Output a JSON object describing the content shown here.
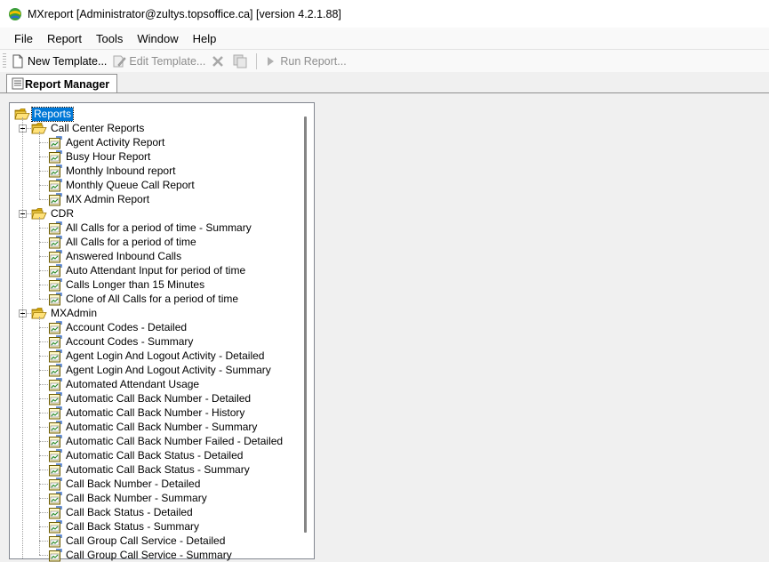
{
  "window": {
    "title": "MXreport [Administrator@zultys.topsoffice.ca] [version 4.2.1.88]"
  },
  "menu": [
    "File",
    "Report",
    "Tools",
    "Window",
    "Help"
  ],
  "toolbar": {
    "new_template": "New Template...",
    "edit_template": "Edit Template...",
    "run_report": "Run Report..."
  },
  "tab": {
    "label": "Report Manager"
  },
  "tree": {
    "root": "Reports",
    "groups": [
      {
        "label": "Call Center Reports",
        "items": [
          "Agent Activity Report",
          "Busy Hour Report",
          "Monthly Inbound report",
          "Monthly Queue Call Report",
          "MX Admin Report"
        ]
      },
      {
        "label": "CDR",
        "items": [
          "All Calls for a period of time -  Summary",
          "All Calls for a period of time",
          "Answered Inbound Calls",
          "Auto Attendant Input for period of time",
          "Calls Longer than 15 Minutes",
          "Clone of All Calls for a period of time"
        ]
      },
      {
        "label": "MXAdmin",
        "items": [
          "Account Codes - Detailed",
          "Account Codes - Summary",
          "Agent Login And Logout Activity - Detailed",
          "Agent Login And Logout Activity - Summary",
          "Automated Attendant Usage",
          "Automatic Call Back Number - Detailed",
          "Automatic Call Back Number - History",
          "Automatic Call Back Number - Summary",
          "Automatic Call Back Number Failed - Detailed",
          "Automatic Call Back Status - Detailed",
          "Automatic Call Back Status - Summary",
          "Call Back Number - Detailed",
          "Call Back Number - Summary",
          "Call Back Status - Detailed",
          "Call Back Status - Summary",
          "Call Group Call Service - Detailed",
          "Call Group Call Service - Summary"
        ]
      }
    ]
  }
}
